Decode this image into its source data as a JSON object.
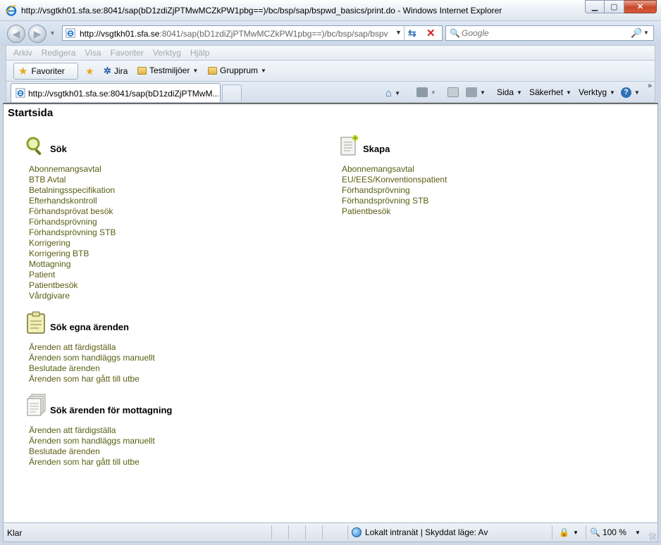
{
  "window": {
    "title": "http://vsgtkh01.sfa.se:8041/sap(bD1zdiZjPTMwMCZkPW1pbg==)/bc/bsp/sap/bspwd_basics/print.do - Windows Internet Explorer",
    "minimize": "▁",
    "maximize": "▢",
    "close": "✕"
  },
  "address": {
    "url_host": "http://vsgtkh01.sfa.se",
    "url_rest": ":8041/sap(bD1zdiZjPTMwMCZkPW1pbg==)/bc/bsp/sap/bspv",
    "search_placeholder": "Google"
  },
  "menu": [
    "Arkiv",
    "Redigera",
    "Visa",
    "Favoriter",
    "Verktyg",
    "Hjälp"
  ],
  "favorites_bar": {
    "favorites_label": "Favoriter",
    "jira": "Jira",
    "testmiljoer": "Testmiljöer",
    "grupprum": "Grupprum"
  },
  "tab": {
    "title": "http://vsgtkh01.sfa.se:8041/sap(bD1zdiZjPTMwM..."
  },
  "commands": {
    "sida": "Sida",
    "sakerhet": "Säkerhet",
    "verktyg": "Verktyg"
  },
  "page": {
    "title": "Startsida",
    "sok": {
      "heading": "Sök",
      "links": [
        "Abonnemangsavtal",
        "BTB Avtal",
        "Betalningsspecifikation",
        "Efterhandskontroll",
        "Förhandsprövat besök",
        "Förhandsprövning",
        "Förhandsprövning STB",
        "Korrigering",
        "Korrigering BTB",
        "Mottagning",
        "Patient",
        "Patientbesök",
        "Vårdgivare"
      ]
    },
    "skapa": {
      "heading": "Skapa",
      "links": [
        "Abonnemangsavtal",
        "EU/EES/Konventionspatient",
        "Förhandsprövning",
        "Förhandsprövning STB",
        "Patientbesök"
      ]
    },
    "egna": {
      "heading": "Sök egna ärenden",
      "links": [
        "Ärenden att färdigställa",
        "Ärenden som handläggs manuellt",
        "Beslutade ärenden",
        "Ärenden som har gått till utbe"
      ]
    },
    "mottagning": {
      "heading": "Sök ärenden för mottagning",
      "links": [
        "Ärenden att färdigställa",
        "Ärenden som handläggs manuellt",
        "Beslutade ärenden",
        "Ärenden som har gått till utbe"
      ]
    }
  },
  "status": {
    "ready": "Klar",
    "zone": "Lokalt intranät | Skyddat läge: Av",
    "zoom": "100 %"
  }
}
